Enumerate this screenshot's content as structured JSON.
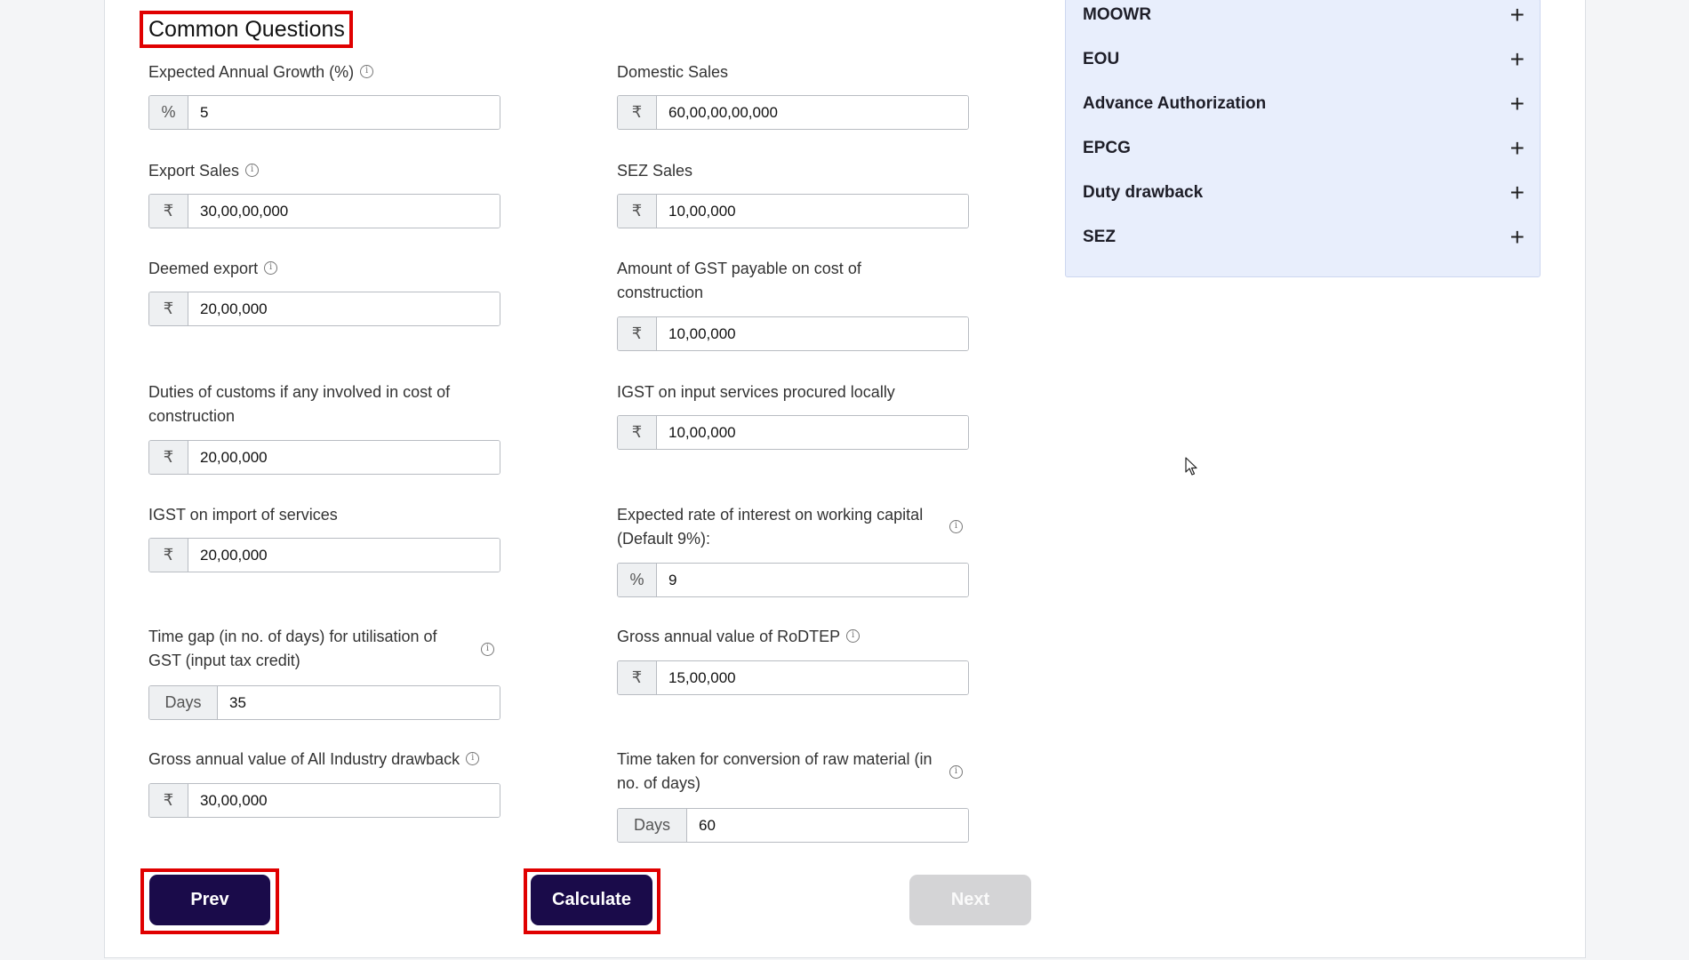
{
  "section_title": "Common Questions",
  "fields": {
    "annual_growth": {
      "label": "Expected Annual Growth (%)",
      "prefix": "%",
      "value": "5"
    },
    "domestic_sales": {
      "label": "Domestic Sales",
      "prefix": "₹",
      "value": "60,00,00,00,000"
    },
    "export_sales": {
      "label": "Export Sales",
      "prefix": "₹",
      "value": "30,00,00,000"
    },
    "sez_sales": {
      "label": "SEZ Sales",
      "prefix": "₹",
      "value": "10,00,000"
    },
    "deemed_export": {
      "label": "Deemed export",
      "prefix": "₹",
      "value": "20,00,000"
    },
    "gst_construction": {
      "label": "Amount of GST payable on cost of construction",
      "prefix": "₹",
      "value": "10,00,000"
    },
    "customs_duties": {
      "label": "Duties of customs if any involved in cost of construction",
      "prefix": "₹",
      "value": "20,00,000"
    },
    "igst_input_services": {
      "label": "IGST on input services procured locally",
      "prefix": "₹",
      "value": "10,00,000"
    },
    "igst_import_services": {
      "label": "IGST on import of services",
      "prefix": "₹",
      "value": "20,00,000"
    },
    "interest_rate": {
      "label": "Expected rate of interest on working capital (Default 9%):",
      "prefix": "%",
      "value": "9"
    },
    "time_gap_gst": {
      "label": "Time gap (in no. of days) for utilisation of GST (input tax credit)",
      "prefix": "Days",
      "value": "35"
    },
    "rodtep": {
      "label": "Gross annual value of RoDTEP",
      "prefix": "₹",
      "value": "15,00,000"
    },
    "all_industry_drawback": {
      "label": "Gross annual value of All Industry drawback",
      "prefix": "₹",
      "value": "30,00,000"
    },
    "raw_material_conversion": {
      "label": "Time taken for conversion of raw material (in no. of days)",
      "prefix": "Days",
      "value": "60"
    }
  },
  "info_icon_glyph": "i",
  "buttons": {
    "prev": "Prev",
    "calculate": "Calculate",
    "next": "Next"
  },
  "sidebar": {
    "plus_glyph": "+",
    "items": [
      {
        "label": "MOOWR"
      },
      {
        "label": "EOU"
      },
      {
        "label": "Advance Authorization"
      },
      {
        "label": "EPCG"
      },
      {
        "label": "Duty drawback"
      },
      {
        "label": "SEZ"
      }
    ]
  },
  "colors": {
    "primary_button": "#1a0b4a",
    "disabled_button": "#d4d4d6",
    "highlight_frame": "#e00000",
    "side_panel_bg": "#e8eefc"
  }
}
